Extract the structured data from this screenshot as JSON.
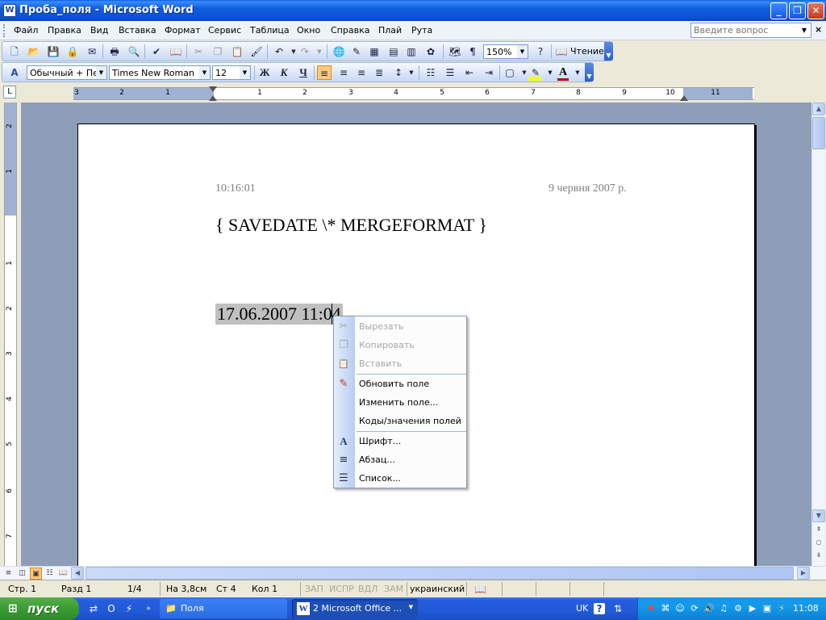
{
  "window": {
    "title": "Проба_поля - Microsoft Word",
    "app_icon": "W",
    "minimize": "_",
    "restore": "❐",
    "close": "✕"
  },
  "menubar": {
    "items": [
      "Файл",
      "Правка",
      "Вид",
      "Вставка",
      "Формат",
      "Сервис",
      "Таблица",
      "Окно",
      "Справка",
      "Плай",
      "Рута"
    ],
    "help_placeholder": "Введите вопрос",
    "doc_close": "×"
  },
  "standard_toolbar": {
    "zoom": "150%",
    "pilcrow": "¶",
    "reading_label": "Чтение"
  },
  "format_toolbar": {
    "style": "Обычный + Пер",
    "font": "Times New Roman",
    "size": "12",
    "bold": "Ж",
    "italic": "К",
    "underline": "Ч",
    "font_color_letter": "A"
  },
  "ruler": {
    "tab_selector": "L",
    "h_numbers": [
      "3",
      "2",
      "1",
      "1",
      "2",
      "3",
      "4",
      "5",
      "6",
      "7",
      "8",
      "9",
      "10",
      "11"
    ],
    "v_numbers": [
      "2",
      "1",
      "1",
      "2",
      "3",
      "4",
      "5",
      "6",
      "7"
    ]
  },
  "document": {
    "header_left": "10:16:01",
    "header_right": "9 червня 2007 р.",
    "field_code": "{ SAVEDATE   \\* MERGEFORMAT }",
    "field_result": "17.06.2007 11:04"
  },
  "context_menu": {
    "items": [
      {
        "label": "Вырезать",
        "icon": "scissors-icon",
        "glyph": "✂",
        "disabled": true
      },
      {
        "label": "Копировать",
        "icon": "copy-icon",
        "glyph": "❐",
        "disabled": true
      },
      {
        "label": "Вставить",
        "icon": "paste-icon",
        "glyph": "📋",
        "disabled": true
      },
      {
        "label": "Обновить поле",
        "icon": "update-field-icon",
        "glyph": "✎",
        "disabled": false
      },
      {
        "label": "Изменить поле...",
        "icon": "",
        "glyph": "",
        "disabled": false
      },
      {
        "label": "Коды/значения полей",
        "icon": "",
        "glyph": "",
        "disabled": false
      },
      {
        "label": "Шрифт...",
        "icon": "font-icon",
        "glyph": "A",
        "disabled": false
      },
      {
        "label": "Абзац...",
        "icon": "paragraph-icon",
        "glyph": "≡",
        "disabled": false
      },
      {
        "label": "Список...",
        "icon": "list-icon",
        "glyph": "☰",
        "disabled": false
      }
    ]
  },
  "statusbar": {
    "page": "Стр. 1",
    "section": "Разд 1",
    "pages": "1/4",
    "at": "На 3,8см",
    "line": "Ст 4",
    "col": "Кол 1",
    "rec": "ЗАП",
    "trk": "ИСПР",
    "ext": "ВДЛ",
    "ovr": "ЗАМ",
    "language": "украинский"
  },
  "taskbar": {
    "start_label": "пуск",
    "tasks": [
      {
        "label": "Поля",
        "icon": "folder-icon"
      },
      {
        "label": "2 Microsoft Office ...",
        "icon": "word-icon"
      }
    ],
    "lang": "UK",
    "clock": "11:08"
  }
}
